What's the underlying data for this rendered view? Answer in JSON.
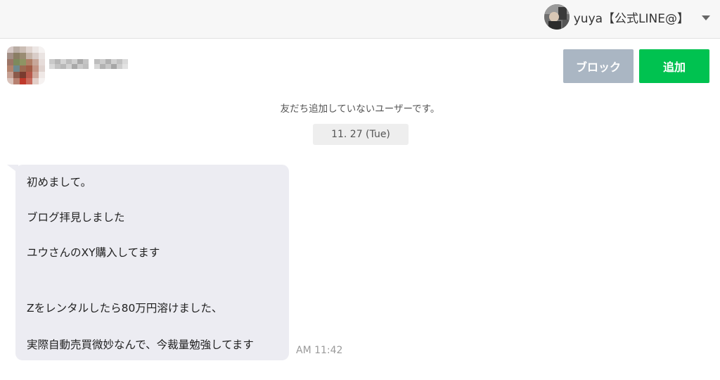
{
  "account": {
    "name": "yuya【公式LINE@】",
    "avatar_icon": "account-avatar-photo",
    "dropdown_icon": "caret-down-icon"
  },
  "chat": {
    "user_avatar_icon": "blurred-user-avatar",
    "user_name_icon": "blurred-user-name",
    "block_button": "ブロック",
    "add_button": "追加",
    "block_color": "#aab6c3",
    "add_color": "#00c250"
  },
  "notice": "友だち追加していないユーザーです。",
  "date_label": "11. 27 (Tue)",
  "message": {
    "lines": [
      "初めまして。",
      "ブログ拝見しました",
      "ユウさんのXY購入してます",
      "Zをレンタルしたら80万円溶けました、",
      "実際自動売買微妙なんで、今裁量勉強してます"
    ],
    "time": "AM 11:42"
  }
}
